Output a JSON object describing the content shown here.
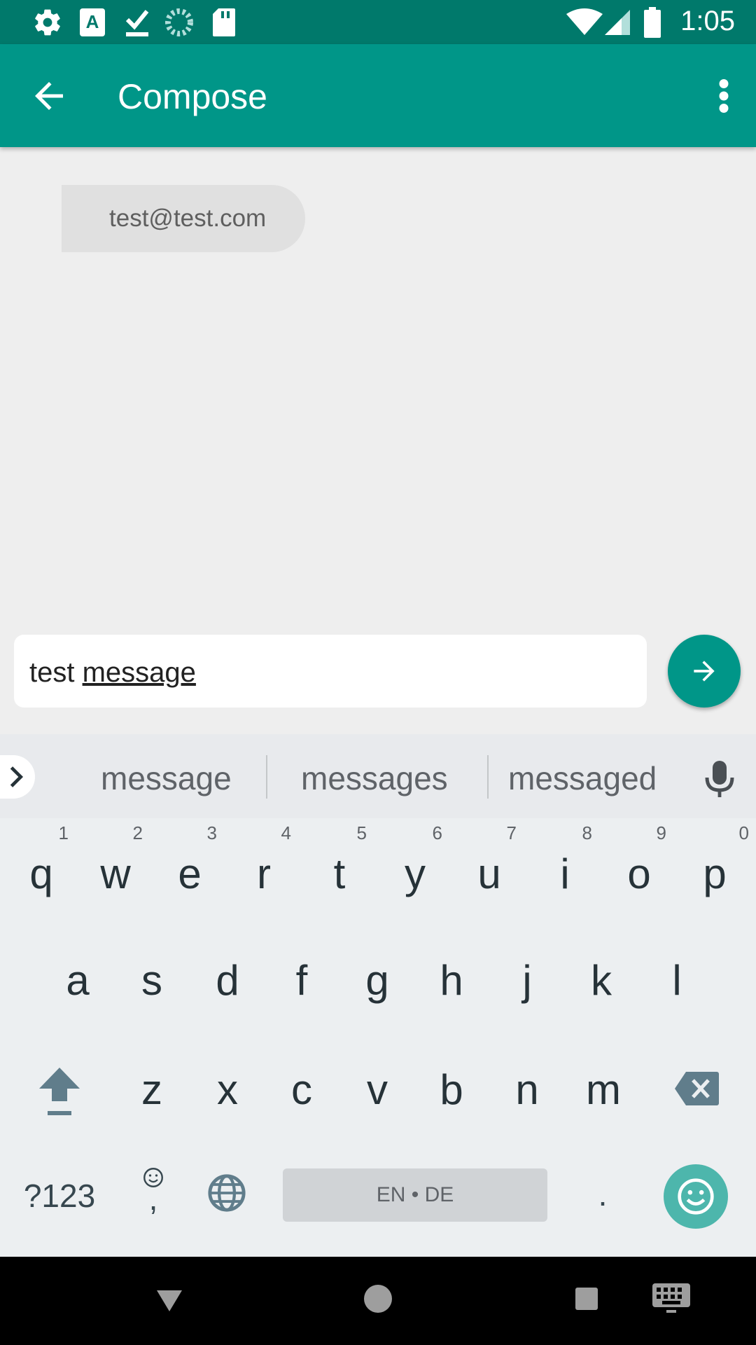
{
  "status_bar": {
    "time": "1:05",
    "left_icons": [
      "settings-icon",
      "font-a-icon",
      "download-done-icon",
      "loading-spinner-icon",
      "sd-card-icon"
    ],
    "right_icons": [
      "wifi-icon",
      "signal-icon",
      "battery-icon"
    ]
  },
  "app_bar": {
    "title": "Compose",
    "color": "#009688"
  },
  "recipient": {
    "address": "test@test.com"
  },
  "composer": {
    "text_plain": "test ",
    "text_underlined": "message"
  },
  "keyboard": {
    "suggestions": [
      "message",
      "messages",
      "messaged"
    ],
    "row1": [
      {
        "key": "q",
        "hint": "1"
      },
      {
        "key": "w",
        "hint": "2"
      },
      {
        "key": "e",
        "hint": "3"
      },
      {
        "key": "r",
        "hint": "4"
      },
      {
        "key": "t",
        "hint": "5"
      },
      {
        "key": "y",
        "hint": "6"
      },
      {
        "key": "u",
        "hint": "7"
      },
      {
        "key": "i",
        "hint": "8"
      },
      {
        "key": "o",
        "hint": "9"
      },
      {
        "key": "p",
        "hint": "0"
      }
    ],
    "row2": [
      "a",
      "s",
      "d",
      "f",
      "g",
      "h",
      "j",
      "k",
      "l"
    ],
    "row3": [
      "z",
      "x",
      "c",
      "v",
      "b",
      "n",
      "m"
    ],
    "symbols_label": "?123",
    "comma_label": ",",
    "space_label": "EN • DE",
    "period_label": "."
  }
}
